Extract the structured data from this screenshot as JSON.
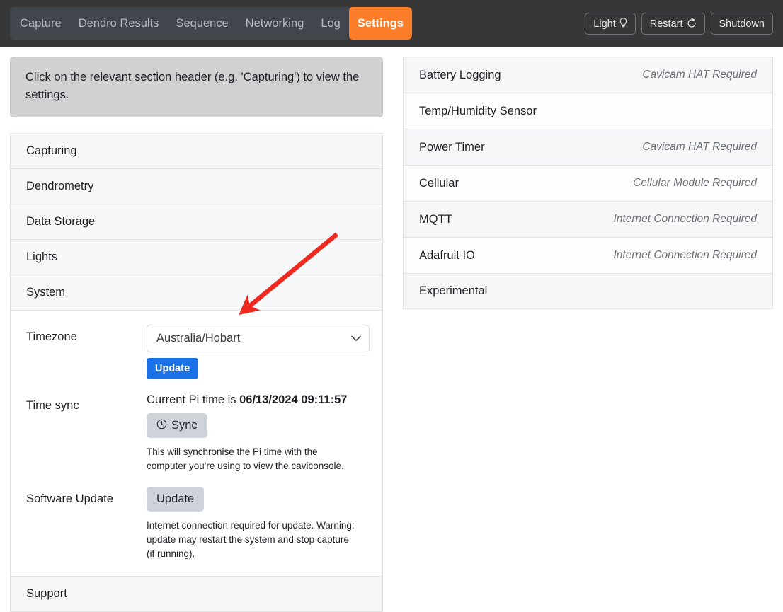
{
  "nav": {
    "tabs": [
      {
        "label": "Capture",
        "active": false
      },
      {
        "label": "Dendro Results",
        "active": false
      },
      {
        "label": "Sequence",
        "active": false
      },
      {
        "label": "Networking",
        "active": false
      },
      {
        "label": "Log",
        "active": false
      },
      {
        "label": "Settings",
        "active": true
      }
    ],
    "actions": [
      {
        "label": "Light",
        "icon": "lightbulb-icon",
        "glyph": "Ὂ1"
      },
      {
        "label": "Restart",
        "icon": "restart-icon",
        "glyph": "↺"
      },
      {
        "label": "Shutdown",
        "icon": "",
        "glyph": ""
      }
    ],
    "accent_color": "#fb7d29",
    "bar_color": "#373737"
  },
  "alert": {
    "text": "Click on the relevant section header (e.g. 'Capturing') to view the settings.",
    "bg_color": "#cfd1d2"
  },
  "left_sections": [
    {
      "label": "Capturing"
    },
    {
      "label": "Dendrometry"
    },
    {
      "label": "Data Storage"
    },
    {
      "label": "Lights"
    },
    {
      "label": "System"
    }
  ],
  "system": {
    "header": "System",
    "timezone": {
      "label": "Timezone",
      "selected": "Australia/Hobart",
      "options": [
        "Australia/Hobart"
      ],
      "update_label": "Update"
    },
    "time_sync": {
      "label": "Time sync",
      "prefix": "Current Pi time is",
      "value": "06/13/2024 09:11:57",
      "button_label": "Sync",
      "button_icon": "clock-icon",
      "helper": "This will synchronise the Pi time with the computer you're using to view the caviconsole."
    },
    "software_update": {
      "label": "Software Update",
      "button_label": "Update",
      "helper": "Internet connection required for update. Warning: update may restart the system and stop capture (if running)."
    }
  },
  "support_section": {
    "label": "Support"
  },
  "right_sections": [
    {
      "label": "Battery Logging",
      "note": "Cavicam HAT Required",
      "shade": "alt"
    },
    {
      "label": "Temp/Humidity Sensor",
      "note": "",
      "shade": "plain"
    },
    {
      "label": "Power Timer",
      "note": "Cavicam HAT Required",
      "shade": "alt"
    },
    {
      "label": "Cellular",
      "note": "Cellular Module Required",
      "shade": "plain"
    },
    {
      "label": "MQTT",
      "note": "Internet Connection Required",
      "shade": "alt"
    },
    {
      "label": "Adafruit IO",
      "note": "Internet Connection Required",
      "shade": "plain"
    },
    {
      "label": "Experimental",
      "note": "",
      "shade": "alt"
    }
  ],
  "annotation": {
    "type": "arrow",
    "color": "#ee2a20",
    "points_at": "timezone-select"
  }
}
